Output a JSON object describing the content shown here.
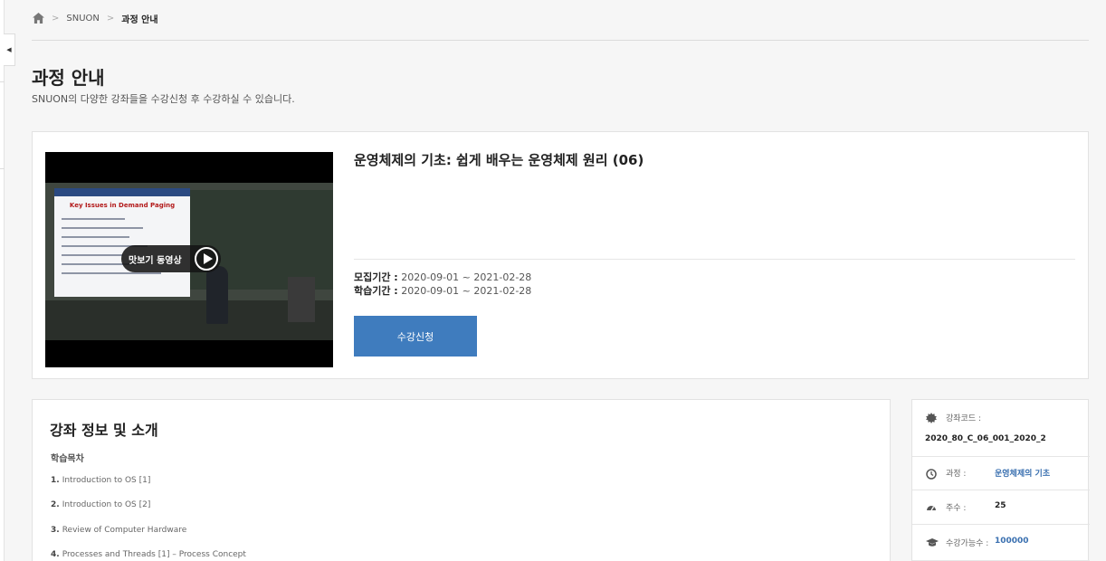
{
  "breadcrumb": {
    "home_icon": "home-icon",
    "items": [
      "SNUON",
      "과정 안내"
    ]
  },
  "header": {
    "title": "과정 안내",
    "subtitle": "SNUON의 다양한 강좌들을 수강신청 후 수강하실 수 있습니다."
  },
  "course": {
    "name": "운영체제의 기초: 쉽게 배우는 운영체제 원리 (06)",
    "video": {
      "preview_label": "맛보기 동영상",
      "play_icon": "play-icon",
      "slide_title": "Key Issues in Demand Paging"
    },
    "recruit_label": "모집기간 :",
    "recruit_period": "2020-09-01 ~ 2021-02-28",
    "study_label": "학습기간 :",
    "study_period": "2020-09-01 ~ 2021-02-28",
    "enroll_button": "수강신청"
  },
  "intro": {
    "title": "강좌 정보 및 소개",
    "outline_heading": "학습목차",
    "outline": [
      {
        "num": "1.",
        "text": "Introduction to OS [1]"
      },
      {
        "num": "2.",
        "text": "Introduction to OS [2]"
      },
      {
        "num": "3.",
        "text": "Review of Computer Hardware"
      },
      {
        "num": "4.",
        "text": "Processes and Threads [1] – Process Concept"
      }
    ]
  },
  "meta": {
    "code_label": "강좌코드 :",
    "code_value": "2020_80_C_06_001_2020_2",
    "course_label": "과정 :",
    "course_value": "운영체제의 기초",
    "weeks_label": "주수 :",
    "weeks_value": "25",
    "capacity_label": "수강가능수 :",
    "capacity_value": "100000"
  },
  "colors": {
    "accent": "#3f7cbe",
    "link": "#3a70b0"
  }
}
